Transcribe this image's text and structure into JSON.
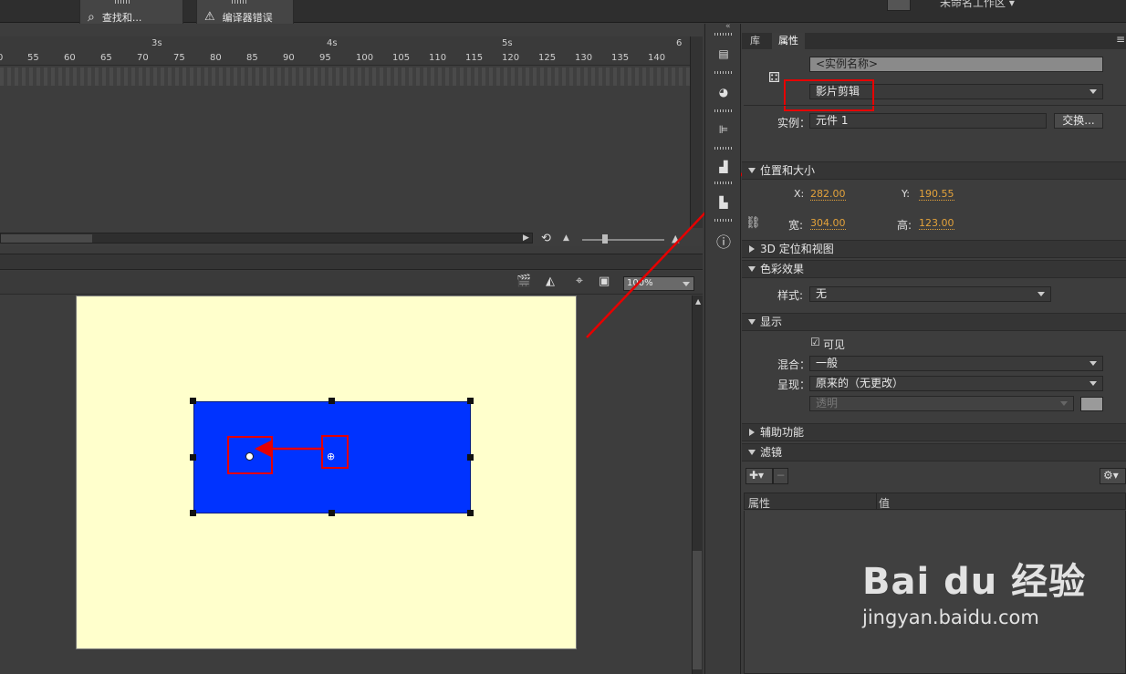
{
  "toolbar": {
    "find_replace_label": "查找和...",
    "compiler_errors_label": "编译器错误",
    "workspace_label": "未命名工作区 ▾"
  },
  "timeline": {
    "seconds": [
      "3s",
      "4s",
      "5s",
      "6"
    ],
    "frame_numbers": [
      "0",
      "55",
      "60",
      "65",
      "70",
      "75",
      "80",
      "85",
      "90",
      "95",
      "100",
      "105",
      "110",
      "115",
      "120",
      "125",
      "130",
      "135",
      "140"
    ]
  },
  "stage": {
    "zoom": "100%",
    "background_color": "#ffffcc",
    "symbol_color": "#0033ff"
  },
  "panel": {
    "tabs": [
      "库",
      "属性"
    ],
    "active_tab": "属性",
    "instance_name_placeholder": "<实例名称>",
    "type_value": "影片剪辑",
    "instance_label": "实例：",
    "instance_value": "元件 1",
    "swap_button": "交换...",
    "position_size": {
      "title": "位置和大小",
      "x_label": "X:",
      "x_value": "282.00",
      "y_label": "Y:",
      "y_value": "190.55",
      "w_label": "宽:",
      "w_value": "304.00",
      "h_label": "高:",
      "h_value": "123.00"
    },
    "section_3d": "3D 定位和视图",
    "color_effect": {
      "title": "色彩效果",
      "style_label": "样式:",
      "style_value": "无"
    },
    "display": {
      "title": "显示",
      "visible_label": "可见",
      "blend_label": "混合：",
      "blend_value": "一般",
      "render_label": "呈现：",
      "render_value": "原来的（无更改）",
      "transparent_value": "透明"
    },
    "accessibility_title": "辅助功能",
    "filters": {
      "title": "滤镜",
      "col_property": "属性",
      "col_value": "值"
    }
  },
  "watermark": {
    "brand": "Bai du 经验",
    "url": "jingyan.baidu.com"
  },
  "colors": {
    "accent_value": "#e3a23b",
    "annotation_red": "#e60000"
  }
}
